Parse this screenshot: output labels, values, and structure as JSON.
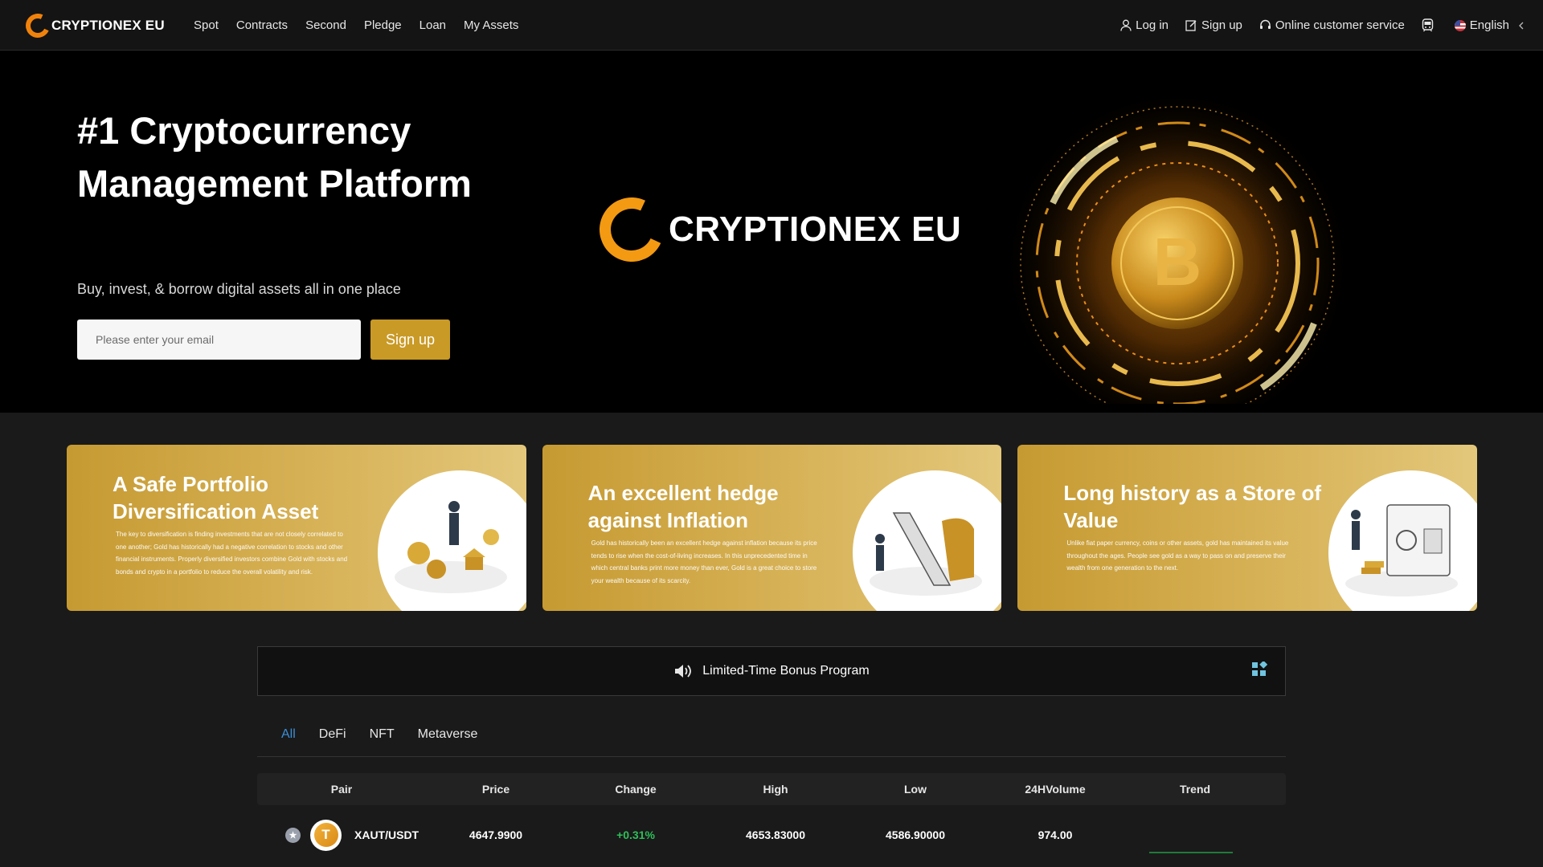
{
  "header": {
    "brand": "CRYPTIONEX EU",
    "nav": [
      "Spot",
      "Contracts",
      "Second",
      "Pledge",
      "Loan",
      "My Assets"
    ],
    "login_label": "Log in",
    "signup_label": "Sign up",
    "service_label": "Online customer service",
    "language_label": "English"
  },
  "hero": {
    "title": "#1 Cryptocurrency Management Platform",
    "subtitle": "Buy, invest, & borrow digital assets all in one place",
    "email_placeholder": "Please enter your email",
    "signup_button": "Sign up",
    "brand_text": "CRYPTIONEX EU"
  },
  "cards": [
    {
      "title": "A Safe Portfolio Diversification Asset",
      "text": "The key to diversification is finding investments that are not closely correlated to one another; Gold has historically had a negative correlation to stocks and other financial instruments. Properly diversified investors combine Gold with stocks and bonds and crypto in a portfolio to reduce the overall volatility and risk."
    },
    {
      "title": "An excellent hedge against Inflation",
      "text": "Gold has historically been an excellent hedge against inflation because its price tends to rise when the cost-of-living increases. In this unprecedented time in which central banks print more money than ever, Gold is a great choice to store your wealth because of its scarcity."
    },
    {
      "title": "Long history as a Store of Value",
      "text": "Unlike fiat paper currency, coins or other assets, gold has maintained its value throughout the ages. People see gold as a way to pass on and preserve their wealth from one generation to the next."
    }
  ],
  "notice": {
    "text": "Limited-Time Bonus Program"
  },
  "tabs": [
    "All",
    "DeFi",
    "NFT",
    "Metaverse"
  ],
  "table": {
    "headers": [
      "Pair",
      "Price",
      "Change",
      "High",
      "Low",
      "24HVolume",
      "Trend"
    ],
    "rows": [
      {
        "coin_symbol": "T",
        "pair": "XAUT/USDT",
        "price": "4647.9900",
        "change": "+0.31%",
        "high": "4653.83000",
        "low": "4586.90000",
        "volume": "974.00"
      }
    ]
  },
  "colors": {
    "accent_gold": "#c99a26",
    "logo_orange": "#f0820c",
    "active_tab": "#3b8fd6",
    "positive": "#2fbf5a"
  }
}
